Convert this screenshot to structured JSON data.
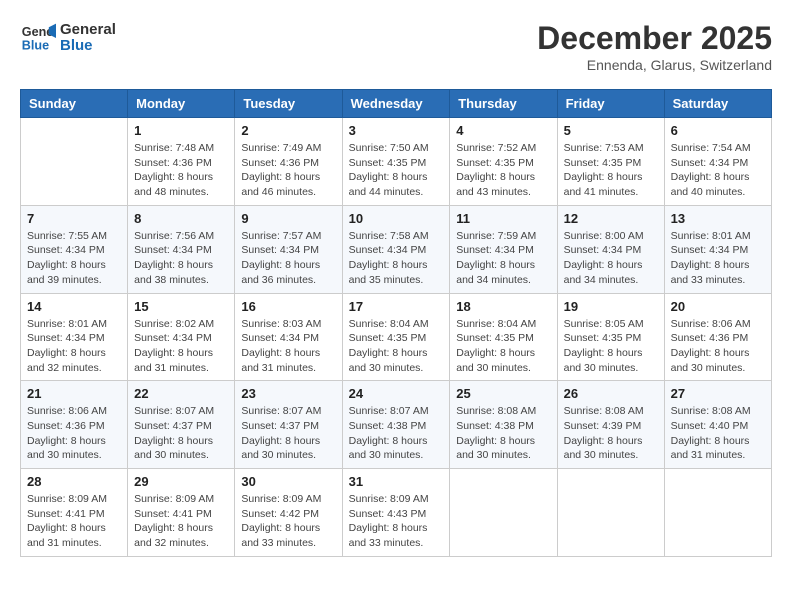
{
  "logo": {
    "line1": "General",
    "line2": "Blue"
  },
  "header": {
    "month": "December 2025",
    "location": "Ennenda, Glarus, Switzerland"
  },
  "weekdays": [
    "Sunday",
    "Monday",
    "Tuesday",
    "Wednesday",
    "Thursday",
    "Friday",
    "Saturday"
  ],
  "weeks": [
    [
      {
        "day": "",
        "info": ""
      },
      {
        "day": "1",
        "info": "Sunrise: 7:48 AM\nSunset: 4:36 PM\nDaylight: 8 hours\nand 48 minutes."
      },
      {
        "day": "2",
        "info": "Sunrise: 7:49 AM\nSunset: 4:36 PM\nDaylight: 8 hours\nand 46 minutes."
      },
      {
        "day": "3",
        "info": "Sunrise: 7:50 AM\nSunset: 4:35 PM\nDaylight: 8 hours\nand 44 minutes."
      },
      {
        "day": "4",
        "info": "Sunrise: 7:52 AM\nSunset: 4:35 PM\nDaylight: 8 hours\nand 43 minutes."
      },
      {
        "day": "5",
        "info": "Sunrise: 7:53 AM\nSunset: 4:35 PM\nDaylight: 8 hours\nand 41 minutes."
      },
      {
        "day": "6",
        "info": "Sunrise: 7:54 AM\nSunset: 4:34 PM\nDaylight: 8 hours\nand 40 minutes."
      }
    ],
    [
      {
        "day": "7",
        "info": "Sunrise: 7:55 AM\nSunset: 4:34 PM\nDaylight: 8 hours\nand 39 minutes."
      },
      {
        "day": "8",
        "info": "Sunrise: 7:56 AM\nSunset: 4:34 PM\nDaylight: 8 hours\nand 38 minutes."
      },
      {
        "day": "9",
        "info": "Sunrise: 7:57 AM\nSunset: 4:34 PM\nDaylight: 8 hours\nand 36 minutes."
      },
      {
        "day": "10",
        "info": "Sunrise: 7:58 AM\nSunset: 4:34 PM\nDaylight: 8 hours\nand 35 minutes."
      },
      {
        "day": "11",
        "info": "Sunrise: 7:59 AM\nSunset: 4:34 PM\nDaylight: 8 hours\nand 34 minutes."
      },
      {
        "day": "12",
        "info": "Sunrise: 8:00 AM\nSunset: 4:34 PM\nDaylight: 8 hours\nand 34 minutes."
      },
      {
        "day": "13",
        "info": "Sunrise: 8:01 AM\nSunset: 4:34 PM\nDaylight: 8 hours\nand 33 minutes."
      }
    ],
    [
      {
        "day": "14",
        "info": "Sunrise: 8:01 AM\nSunset: 4:34 PM\nDaylight: 8 hours\nand 32 minutes."
      },
      {
        "day": "15",
        "info": "Sunrise: 8:02 AM\nSunset: 4:34 PM\nDaylight: 8 hours\nand 31 minutes."
      },
      {
        "day": "16",
        "info": "Sunrise: 8:03 AM\nSunset: 4:34 PM\nDaylight: 8 hours\nand 31 minutes."
      },
      {
        "day": "17",
        "info": "Sunrise: 8:04 AM\nSunset: 4:35 PM\nDaylight: 8 hours\nand 30 minutes."
      },
      {
        "day": "18",
        "info": "Sunrise: 8:04 AM\nSunset: 4:35 PM\nDaylight: 8 hours\nand 30 minutes."
      },
      {
        "day": "19",
        "info": "Sunrise: 8:05 AM\nSunset: 4:35 PM\nDaylight: 8 hours\nand 30 minutes."
      },
      {
        "day": "20",
        "info": "Sunrise: 8:06 AM\nSunset: 4:36 PM\nDaylight: 8 hours\nand 30 minutes."
      }
    ],
    [
      {
        "day": "21",
        "info": "Sunrise: 8:06 AM\nSunset: 4:36 PM\nDaylight: 8 hours\nand 30 minutes."
      },
      {
        "day": "22",
        "info": "Sunrise: 8:07 AM\nSunset: 4:37 PM\nDaylight: 8 hours\nand 30 minutes."
      },
      {
        "day": "23",
        "info": "Sunrise: 8:07 AM\nSunset: 4:37 PM\nDaylight: 8 hours\nand 30 minutes."
      },
      {
        "day": "24",
        "info": "Sunrise: 8:07 AM\nSunset: 4:38 PM\nDaylight: 8 hours\nand 30 minutes."
      },
      {
        "day": "25",
        "info": "Sunrise: 8:08 AM\nSunset: 4:38 PM\nDaylight: 8 hours\nand 30 minutes."
      },
      {
        "day": "26",
        "info": "Sunrise: 8:08 AM\nSunset: 4:39 PM\nDaylight: 8 hours\nand 30 minutes."
      },
      {
        "day": "27",
        "info": "Sunrise: 8:08 AM\nSunset: 4:40 PM\nDaylight: 8 hours\nand 31 minutes."
      }
    ],
    [
      {
        "day": "28",
        "info": "Sunrise: 8:09 AM\nSunset: 4:41 PM\nDaylight: 8 hours\nand 31 minutes."
      },
      {
        "day": "29",
        "info": "Sunrise: 8:09 AM\nSunset: 4:41 PM\nDaylight: 8 hours\nand 32 minutes."
      },
      {
        "day": "30",
        "info": "Sunrise: 8:09 AM\nSunset: 4:42 PM\nDaylight: 8 hours\nand 33 minutes."
      },
      {
        "day": "31",
        "info": "Sunrise: 8:09 AM\nSunset: 4:43 PM\nDaylight: 8 hours\nand 33 minutes."
      },
      {
        "day": "",
        "info": ""
      },
      {
        "day": "",
        "info": ""
      },
      {
        "day": "",
        "info": ""
      }
    ]
  ]
}
